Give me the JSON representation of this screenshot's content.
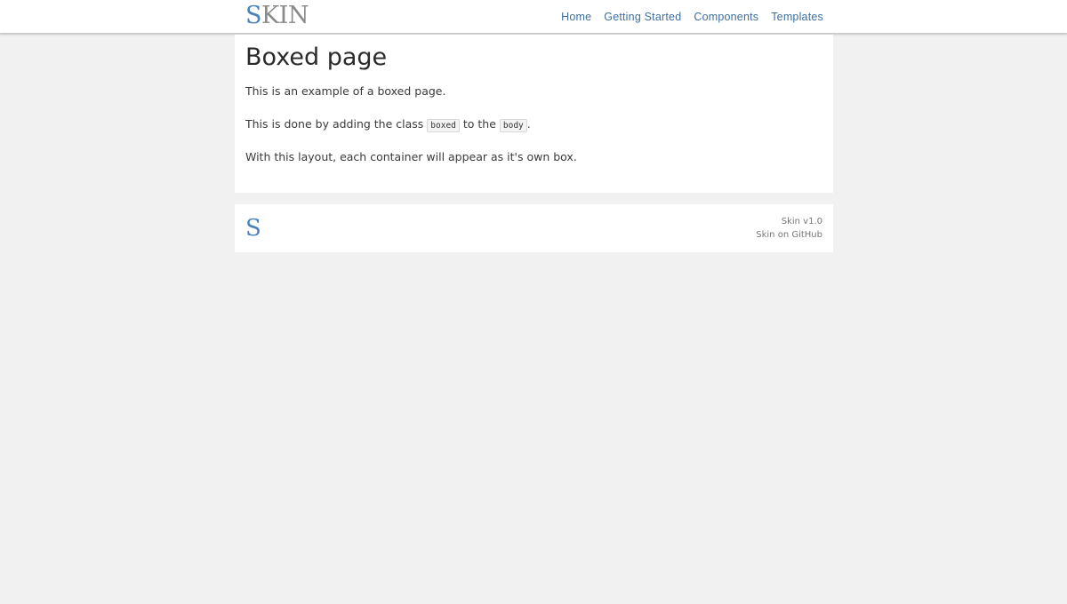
{
  "header": {
    "logo": {
      "s": "S",
      "rest": "KIN"
    },
    "nav": [
      {
        "label": "Home"
      },
      {
        "label": "Getting Started"
      },
      {
        "label": "Components"
      },
      {
        "label": "Templates"
      }
    ]
  },
  "main": {
    "title": "Boxed page",
    "p1": "This is an example of a boxed page.",
    "p2": {
      "before": "This is done by adding the class ",
      "code1": "boxed",
      "middle": " to the ",
      "code2": "body",
      "after": "."
    },
    "p3": "With this layout, each container will appear as it's own box."
  },
  "footer": {
    "logo": "S",
    "version": "Skin v1.0",
    "github": "Skin on GitHub"
  },
  "colors": {
    "background": "#f1f1f1",
    "link": "#3f6f9f",
    "logo_accent": "#4a82bd",
    "logo_gray": "#8a8a8a"
  }
}
